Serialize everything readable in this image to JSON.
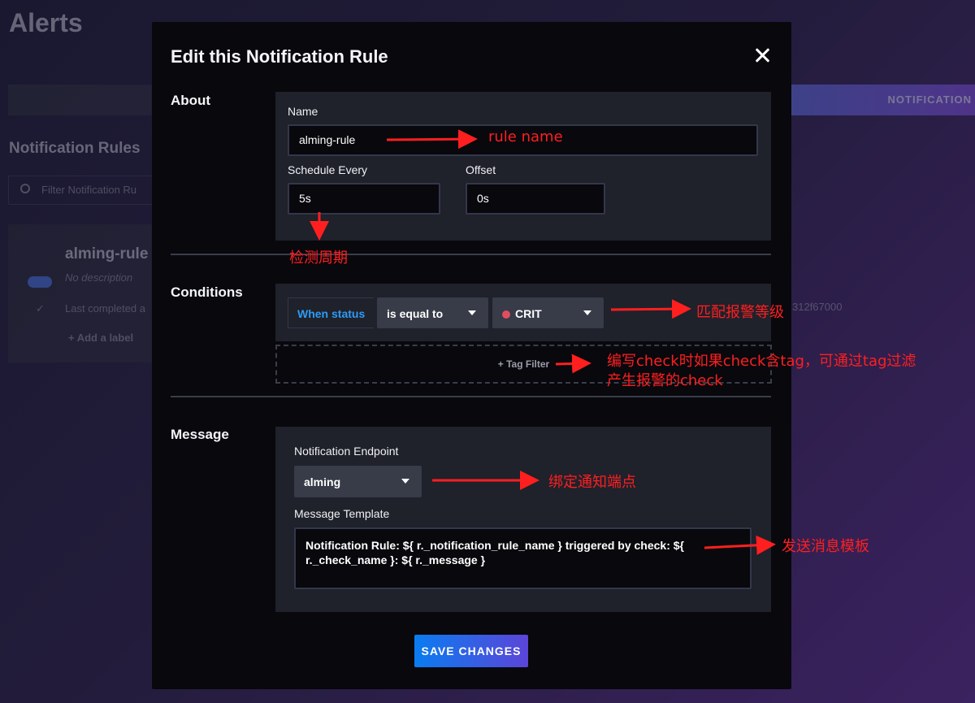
{
  "background": {
    "page_title": "Alerts",
    "tab_right": "NOTIFICATION",
    "section_title": "Notification Rules",
    "filter_placeholder": "Filter Notification Ru",
    "rule_name": "alming-rule",
    "rule_description": "No description",
    "last_completed": "Last completed a",
    "add_label": "+ Add a label",
    "id_fragment": "312f67000"
  },
  "modal": {
    "title": "Edit this Notification Rule",
    "about": {
      "section_label": "About",
      "name_label": "Name",
      "name_value": "alming-rule",
      "schedule_label": "Schedule Every",
      "schedule_value": "5s",
      "offset_label": "Offset",
      "offset_value": "0s"
    },
    "conditions": {
      "section_label": "Conditions",
      "when_label": "When status",
      "operator": "is equal to",
      "level": "CRIT",
      "tag_filter": "+ Tag Filter"
    },
    "message": {
      "section_label": "Message",
      "endpoint_label": "Notification Endpoint",
      "endpoint_value": "alming",
      "template_label": "Message Template",
      "template_value": "Notification Rule: ${ r._notification_rule_name } triggered by check: ${ r._check_name }: ${ r._message }"
    },
    "save_label": "SAVE CHANGES"
  },
  "annotations": {
    "rule_name": "rule name",
    "schedule": "检测周期",
    "level": "匹配报警等级",
    "tag_line1": "编写check时如果check含tag，可通过tag过滤",
    "tag_line2": "产生报警的check",
    "endpoint": "绑定通知端点",
    "template": "发送消息模板"
  },
  "colors": {
    "accent_blue": "#2e9bf5",
    "crit_dot": "#e24d60",
    "annotation_red": "#ff1f1f",
    "save_gradient_start": "#0a7cf0",
    "save_gradient_end": "#5b45d8"
  }
}
